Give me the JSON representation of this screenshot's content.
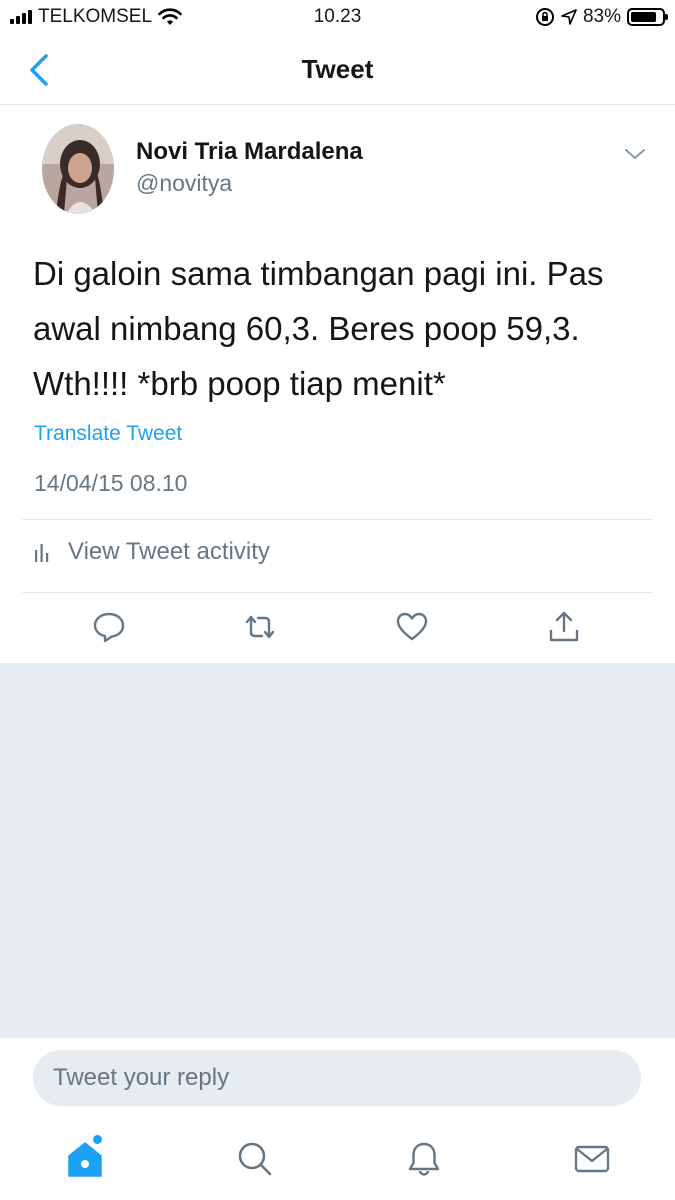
{
  "status_bar": {
    "carrier": "TELKOMSEL",
    "time": "10.23",
    "battery_percent": "83%",
    "battery_level": 0.83
  },
  "nav": {
    "title": "Tweet"
  },
  "tweet": {
    "author_name": "Novi Tria Mardalena",
    "author_handle": "@novitya",
    "text": "Di galoin sama timbangan pagi ini. Pas\nawal nimbang 60,3. Beres poop 59,3.\nWth!!!! *brb poop tiap menit*",
    "translate_label": "Translate Tweet",
    "timestamp": "14/04/15 08.10",
    "activity_label": "View Tweet activity"
  },
  "reply": {
    "placeholder": "Tweet your reply"
  },
  "colors": {
    "accent": "#1da1f2",
    "secondary_text": "#657786",
    "background_grey": "#e6ecf0"
  },
  "icons": {
    "actions": [
      "reply-icon",
      "retweet-icon",
      "like-icon",
      "share-icon"
    ],
    "tabs": [
      "home-icon",
      "search-icon",
      "notifications-icon",
      "messages-icon"
    ]
  }
}
